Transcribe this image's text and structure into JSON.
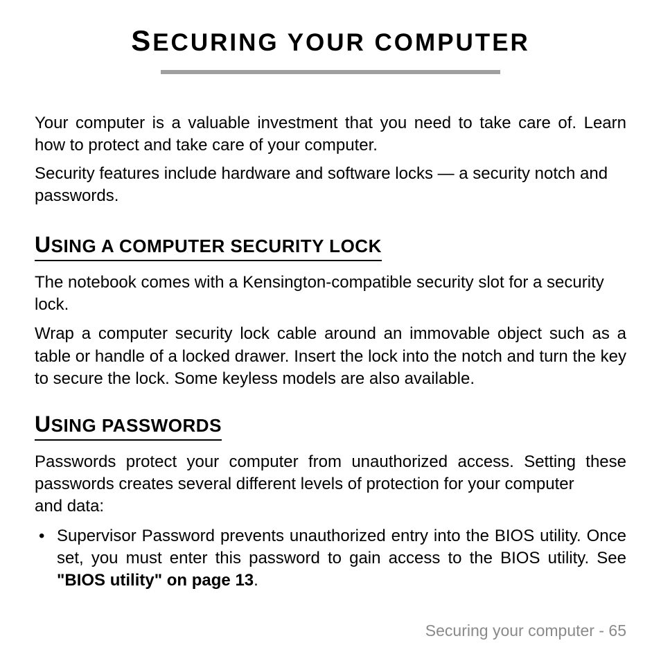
{
  "title": {
    "cap": "S",
    "rest": "ECURING YOUR COMPUTER"
  },
  "intro": {
    "p1": "Your computer is a valuable investment that you need to take care of. Learn how to protect and take care of your computer.",
    "p2": "Security features include hardware and software locks — a security notch and passwords."
  },
  "section1": {
    "heading_cap": "U",
    "heading_rest": "SING A COMPUTER SECURITY LOCK",
    "p1": "The notebook comes with a Kensington-compatible security slot for a security lock.",
    "p2": "Wrap a computer security lock cable around an immovable object such as a table or handle of a locked drawer. Insert the lock into the notch and turn the key to secure the lock. Some keyless models are also available."
  },
  "section2": {
    "heading_cap": "U",
    "heading_rest": "SING PASSWORDS",
    "p1a": "Passwords protect your computer from unauthorized access. Setting these passwords creates several different levels of protection for your computer",
    "p1b": "and data:",
    "bullet_pre": "Supervisor Password prevents unauthorized entry into the BIOS utility. Once set, you must enter this password to gain access to the BIOS utility. See ",
    "bullet_bold": "\"BIOS utility\" on page 13",
    "bullet_post": "."
  },
  "footer": {
    "text": "Securing your computer -  65"
  }
}
